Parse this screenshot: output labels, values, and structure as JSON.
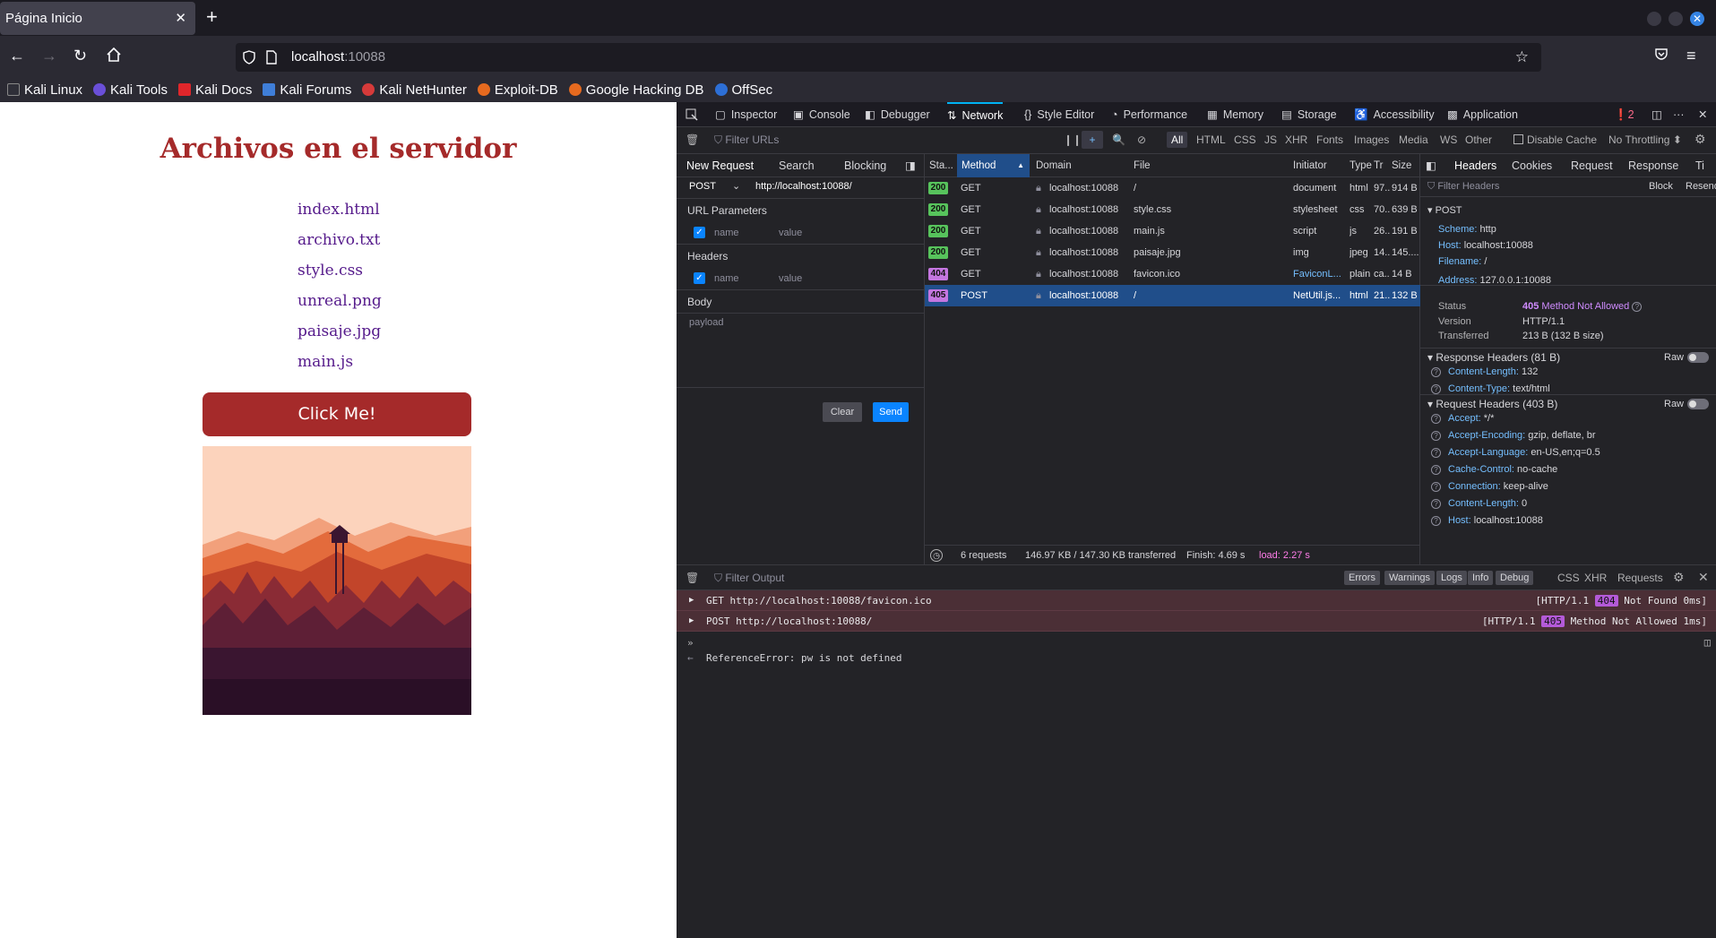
{
  "browser": {
    "tab_title": "Página Inicio",
    "tab_close": "✕",
    "new_tab": "+",
    "url_host": "localhost",
    "url_port": ":10088",
    "bookmarks": [
      "Kali Linux",
      "Kali Tools",
      "Kali Docs",
      "Kali Forums",
      "Kali NetHunter",
      "Exploit-DB",
      "Google Hacking DB",
      "OffSec"
    ]
  },
  "page": {
    "title": "Archivos en el servidor",
    "files": [
      "index.html",
      "archivo.txt",
      "style.css",
      "unreal.png",
      "paisaje.jpg",
      "main.js"
    ],
    "button_label": "Click Me!"
  },
  "devtools": {
    "tabs": [
      "Inspector",
      "Console",
      "Debugger",
      "Network",
      "Style Editor",
      "Performance",
      "Memory",
      "Storage",
      "Accessibility",
      "Application"
    ],
    "active_tab": "Network",
    "error_count": "2",
    "filter_urls_placeholder": "Filter URLs",
    "type_filters": [
      "All",
      "HTML",
      "CSS",
      "JS",
      "XHR",
      "Fonts",
      "Images",
      "Media",
      "WS",
      "Other"
    ],
    "disable_cache": "Disable Cache",
    "throttling": "No Throttling ⬍",
    "new_request": {
      "tabs": [
        "New Request",
        "Search",
        "Blocking"
      ],
      "method": "POST",
      "url": "http://localhost:10088/",
      "url_params_label": "URL Parameters",
      "headers_label": "Headers",
      "body_label": "Body",
      "name_placeholder": "name",
      "value_placeholder": "value",
      "payload_placeholder": "payload",
      "clear": "Clear",
      "send": "Send"
    },
    "request_list": {
      "columns": [
        "Sta...",
        "Method",
        "Domain",
        "File",
        "Initiator",
        "Type",
        "Tr",
        "Size"
      ],
      "rows": [
        {
          "status": "200",
          "method": "GET",
          "domain": "localhost:10088",
          "file": "/",
          "initiator": "document",
          "type": "html",
          "tr": "97...",
          "size": "914 B"
        },
        {
          "status": "200",
          "method": "GET",
          "domain": "localhost:10088",
          "file": "style.css",
          "initiator": "stylesheet",
          "type": "css",
          "tr": "70...",
          "size": "639 B"
        },
        {
          "status": "200",
          "method": "GET",
          "domain": "localhost:10088",
          "file": "main.js",
          "initiator": "script",
          "type": "js",
          "tr": "26...",
          "size": "191 B"
        },
        {
          "status": "200",
          "method": "GET",
          "domain": "localhost:10088",
          "file": "paisaje.jpg",
          "initiator": "img",
          "type": "jpeg",
          "tr": "14...",
          "size": "145...."
        },
        {
          "status": "404",
          "method": "GET",
          "domain": "localhost:10088",
          "file": "favicon.ico",
          "initiator": "FaviconL...",
          "type": "plain",
          "tr": "ca...",
          "size": "14 B"
        },
        {
          "status": "405",
          "method": "POST",
          "domain": "localhost:10088",
          "file": "/",
          "initiator": "NetUtil.js...",
          "type": "html",
          "tr": "21...",
          "size": "132 B"
        }
      ],
      "footer": {
        "requests": "6 requests",
        "transferred": "146.97 KB / 147.30 KB transferred",
        "finish": "Finish: 4.69 s",
        "load": "load: 2.27 s"
      }
    },
    "headers_panel": {
      "tabs": [
        "Headers",
        "Cookies",
        "Request",
        "Response",
        "Ti"
      ],
      "filter_placeholder": "Filter Headers",
      "block": "Block",
      "resend": "Resend",
      "method_label": "POST",
      "summary": [
        {
          "k": "Scheme:",
          "v": "http"
        },
        {
          "k": "Host:",
          "v": "localhost:10088"
        },
        {
          "k": "Filename:",
          "v": "/"
        },
        {
          "k": "Address:",
          "v": "127.0.0.1:10088"
        }
      ],
      "status_label": "Status",
      "status_code": "405",
      "status_text": "Method Not Allowed",
      "version_label": "Version",
      "version": "HTTP/1.1",
      "transferred_label": "Transferred",
      "transferred": "213 B (132 B size)",
      "response_headers_title": "Response Headers (81 B)",
      "raw": "Raw",
      "response_headers": [
        {
          "k": "Content-Length:",
          "v": "132"
        },
        {
          "k": "Content-Type:",
          "v": "text/html"
        }
      ],
      "request_headers_title": "Request Headers (403 B)",
      "request_headers": [
        {
          "k": "Accept:",
          "v": "*/*"
        },
        {
          "k": "Accept-Encoding:",
          "v": "gzip, deflate, br"
        },
        {
          "k": "Accept-Language:",
          "v": "en-US,en;q=0.5"
        },
        {
          "k": "Cache-Control:",
          "v": "no-cache"
        },
        {
          "k": "Connection:",
          "v": "keep-alive"
        },
        {
          "k": "Content-Length:",
          "v": "0"
        },
        {
          "k": "Host:",
          "v": "localhost:10088"
        }
      ]
    },
    "console": {
      "filter_placeholder": "Filter Output",
      "level_buttons": [
        "Errors",
        "Warnings",
        "Logs",
        "Info",
        "Debug"
      ],
      "extra_filters": [
        "CSS",
        "XHR",
        "Requests"
      ],
      "messages": [
        {
          "text": "GET http://localhost:10088/favicon.ico",
          "right_pre": "[HTTP/1.1 ",
          "code": "404",
          "right_post": " Not Found 0ms]"
        },
        {
          "text": "POST http://localhost:10088/",
          "right_pre": "[HTTP/1.1 ",
          "code": "405",
          "right_post": " Method Not Allowed 1ms]"
        }
      ],
      "output": "ReferenceError: pw is not defined",
      "prompt": "»"
    }
  }
}
